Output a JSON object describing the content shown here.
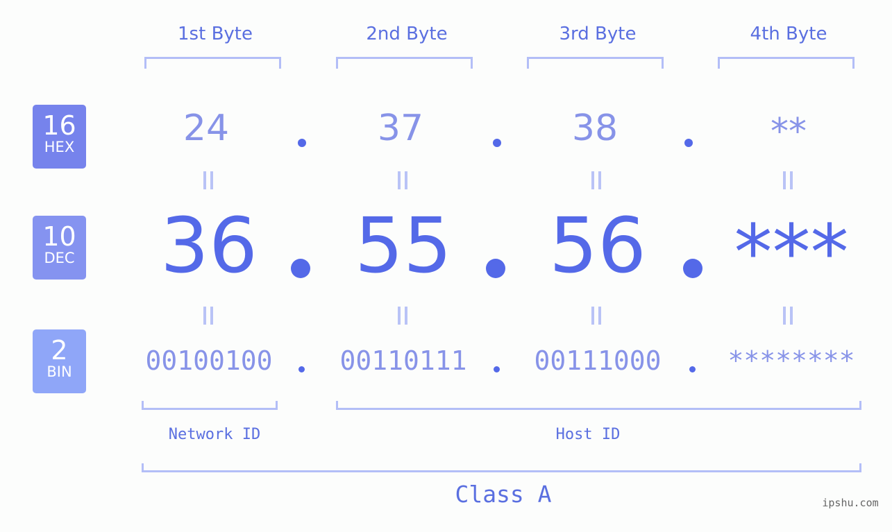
{
  "columns": [
    {
      "header": "1st Byte",
      "hex": "24",
      "dec": "36",
      "bin": "00100100"
    },
    {
      "header": "2nd Byte",
      "hex": "37",
      "dec": "55",
      "bin": "00110111"
    },
    {
      "header": "3rd Byte",
      "hex": "38",
      "dec": "56",
      "bin": "00111000"
    },
    {
      "header": "4th Byte",
      "hex": "**",
      "dec": "***",
      "bin": "********"
    }
  ],
  "rows": {
    "hex": {
      "base": "16",
      "label": "HEX",
      "color": "#7683ec"
    },
    "dec": {
      "base": "10",
      "label": "DEC",
      "color": "#8593f0"
    },
    "bin": {
      "base": "2",
      "label": "BIN",
      "color": "#8fa6f8"
    }
  },
  "segments": {
    "network": "Network ID",
    "host": "Host ID",
    "class": "Class A"
  },
  "watermark": "ipshu.com",
  "colors": {
    "accent": "#5469e8",
    "light": "#8793e8",
    "bracket": "#b3bef7"
  }
}
